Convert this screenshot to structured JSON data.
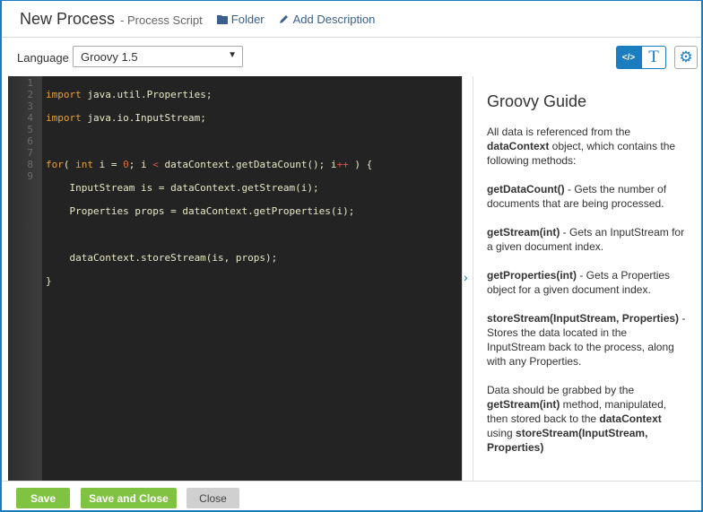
{
  "header": {
    "title": "New Process",
    "subtitle": "- Process Script",
    "folder": "Folder",
    "add_description": "Add Description"
  },
  "toolbar": {
    "language_label": "Language",
    "language_value": "Groovy 1.5"
  },
  "editor": {
    "line_numbers": [
      "1",
      "2",
      "3",
      "4",
      "5",
      "6",
      "7",
      "8",
      "9"
    ],
    "lines": [
      "import java.util.Properties;",
      "import java.io.InputStream;",
      "",
      "for( int i = 0; i < dataContext.getDataCount(); i++ ) {",
      "    InputStream is = dataContext.getStream(i);",
      "    Properties props = dataContext.getProperties(i);",
      "",
      "    dataContext.storeStream(is, props);",
      "}"
    ]
  },
  "guide": {
    "title": "Groovy Guide",
    "p1a": "All data is referenced from the ",
    "p1b": "dataContext",
    "p1c": " object, which contains the following methods:",
    "m1": "getDataCount()",
    "m1d": " - Gets the number of documents that are being processed.",
    "m2": "getStream(int)",
    "m2d": " - Gets an InputStream for a given document index.",
    "m3": "getProperties(int)",
    "m3d": " - Gets a Properties object for a given document index.",
    "m4": "storeStream(InputStream, Properties)",
    "m4d": " - Stores the data located in the InputStream back to the process, along with any Properties.",
    "p6a": "Data should be grabbed by the ",
    "p6b": "getStream(int)",
    "p6c": " method, manipulated, then stored back to the ",
    "p6d": "dataContext",
    "p6e": " using ",
    "p6f": "storeStream(InputStream, Properties)"
  },
  "footer": {
    "save": "Save",
    "save_close": "Save and Close",
    "close": "Close"
  },
  "colors": {
    "accent": "#1b7cc0",
    "save_green": "#80c342"
  }
}
